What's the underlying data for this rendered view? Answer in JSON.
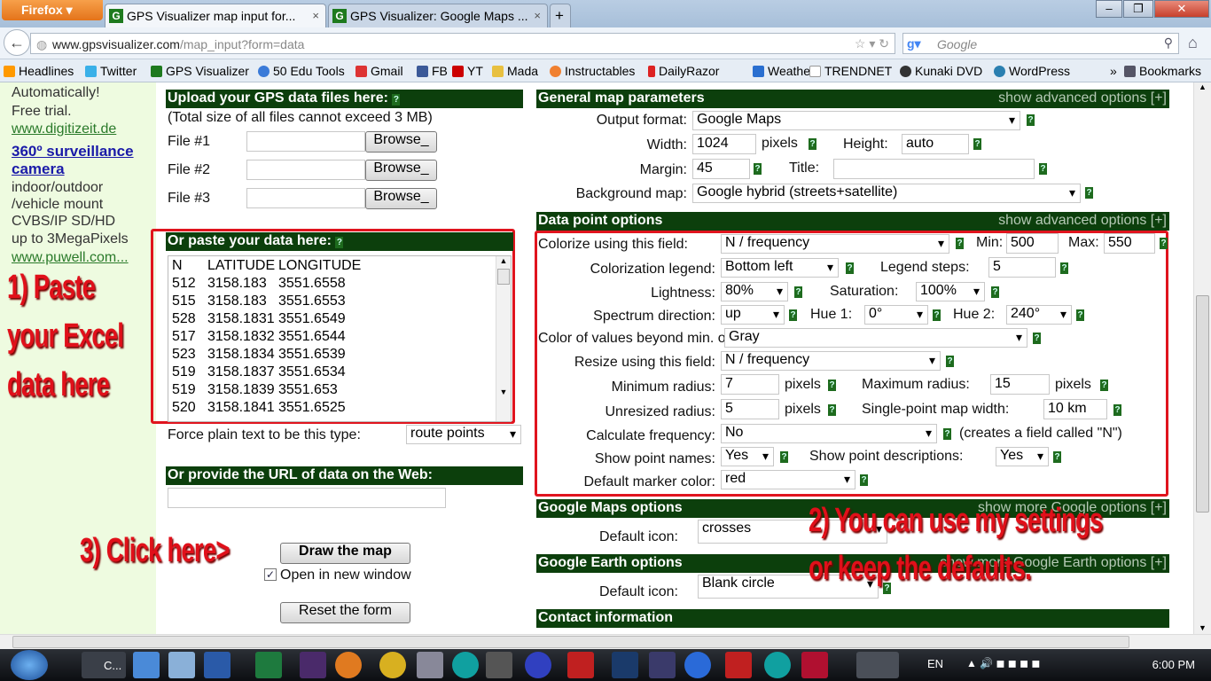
{
  "browser": {
    "app_button": "Firefox",
    "tabs": [
      {
        "label": "GPS Visualizer map input for...",
        "favicon": "G"
      },
      {
        "label": "GPS Visualizer: Google Maps ...",
        "favicon": "G"
      }
    ],
    "new_tab": "+",
    "url_domain": "www.gpsvisualizer.com",
    "url_path": "/map_input?form=data",
    "search_placeholder": "Google",
    "bookmarks": [
      "Headlines",
      "Twitter",
      "GPS Visualizer",
      "50 Edu Tools",
      "Gmail",
      "FB",
      "YT",
      "Mada",
      "Instructables",
      "DailyRazor",
      "Weather",
      "TRENDNET",
      "Kunaki DVD",
      "WordPress"
    ],
    "bookmarks_overflow": "»",
    "bookmarks_menu": "Bookmarks"
  },
  "ad": {
    "line1": "Automatically!",
    "line2": "Free trial.",
    "link1": "www.digitizeit.de",
    "title1": "360º surveillance",
    "title2": "camera",
    "desc": [
      "indoor/outdoor",
      "/vehicle mount",
      "CVBS/IP SD/HD",
      "up to 3MegaPixels"
    ],
    "link2": "www.puwell.com..."
  },
  "annotations": {
    "a1": [
      "1) Paste",
      "your Excel",
      "data here"
    ],
    "a2": [
      "2) You can use my settings",
      "or keep the defaults."
    ],
    "a3": "3) Click here>"
  },
  "upload": {
    "header": "Upload your GPS data files here:",
    "note": "(Total size of all files cannot exceed 3 MB)",
    "files": [
      "File #1",
      "File #2",
      "File #3"
    ],
    "browse": "Browse_"
  },
  "paste": {
    "header": "Or paste your data here:",
    "rows": [
      [
        "N",
        "LATITUDE",
        "LONGITUDE"
      ],
      [
        "512",
        "3158.183",
        "3551.6558"
      ],
      [
        "515",
        "3158.183",
        "3551.6553"
      ],
      [
        "528",
        "3158.1831",
        "3551.6549"
      ],
      [
        "517",
        "3158.1832",
        "3551.6544"
      ],
      [
        "523",
        "3158.1834",
        "3551.6539"
      ],
      [
        "519",
        "3158.1837",
        "3551.6534"
      ],
      [
        "519",
        "3158.1839",
        "3551.653"
      ],
      [
        "520",
        "3158.1841",
        "3551.6525"
      ]
    ],
    "force_label": "Force plain text to be this type:",
    "force_value": "route points"
  },
  "url_section": {
    "header": "Or provide the URL of data on the Web:"
  },
  "actions": {
    "draw": "Draw the map",
    "open_new": "Open in new window",
    "reset": "Reset the form"
  },
  "general": {
    "header": "General map parameters",
    "more": "show advanced options [+]",
    "output_label": "Output format:",
    "output": "Google Maps",
    "width_label": "Width:",
    "width": "1024",
    "pixels": "pixels",
    "height_label": "Height:",
    "height": "auto",
    "margin_label": "Margin:",
    "margin": "45",
    "title_label": "Title:",
    "title": "",
    "bg_label": "Background map:",
    "bg": "Google hybrid (streets+satellite)"
  },
  "datapoint": {
    "header": "Data point options",
    "more": "show advanced options [+]",
    "colorize_label": "Colorize using this field:",
    "colorize": "N / frequency",
    "min_label": "Min:",
    "min": "500",
    "max_label": "Max:",
    "max": "550",
    "legend_label": "Colorization legend:",
    "legend": "Bottom left",
    "steps_label": "Legend steps:",
    "steps": "5",
    "light_label": "Lightness:",
    "light": "80%",
    "sat_label": "Saturation:",
    "sat": "100%",
    "spec_label": "Spectrum direction:",
    "spec": "up",
    "hue1_label": "Hue 1:",
    "hue1": "0°",
    "hue2_label": "Hue 2:",
    "hue2": "240°",
    "beyond_label": "Color of values beyond min. or max.:",
    "beyond": "Gray",
    "resize_label": "Resize using this field:",
    "resize": "N / frequency",
    "minr_label": "Minimum radius:",
    "minr": "7",
    "maxr_label": "Maximum radius:",
    "maxr": "15",
    "unr_label": "Unresized radius:",
    "unr": "5",
    "spw_label": "Single-point map width:",
    "spw": "10 km",
    "freq_label": "Calculate frequency:",
    "freq": "No",
    "freq_note": "(creates a field called \"N\")",
    "names_label": "Show point names:",
    "names": "Yes",
    "desc_label": "Show point descriptions:",
    "desc": "Yes",
    "marker_label": "Default marker color:",
    "marker": "red"
  },
  "gmaps": {
    "header": "Google Maps options",
    "more": "show more Google options [+]",
    "icon_label": "Default icon:",
    "icon": "crosses"
  },
  "gearth": {
    "header": "Google Earth options",
    "more": "show more Google Earth options [+]",
    "icon_label": "Default icon:",
    "icon": "Blank circle"
  },
  "contact": {
    "header": "Contact information"
  },
  "taskbar": {
    "explorer_label": "C...",
    "lang": "EN",
    "time": "6:00 PM"
  }
}
